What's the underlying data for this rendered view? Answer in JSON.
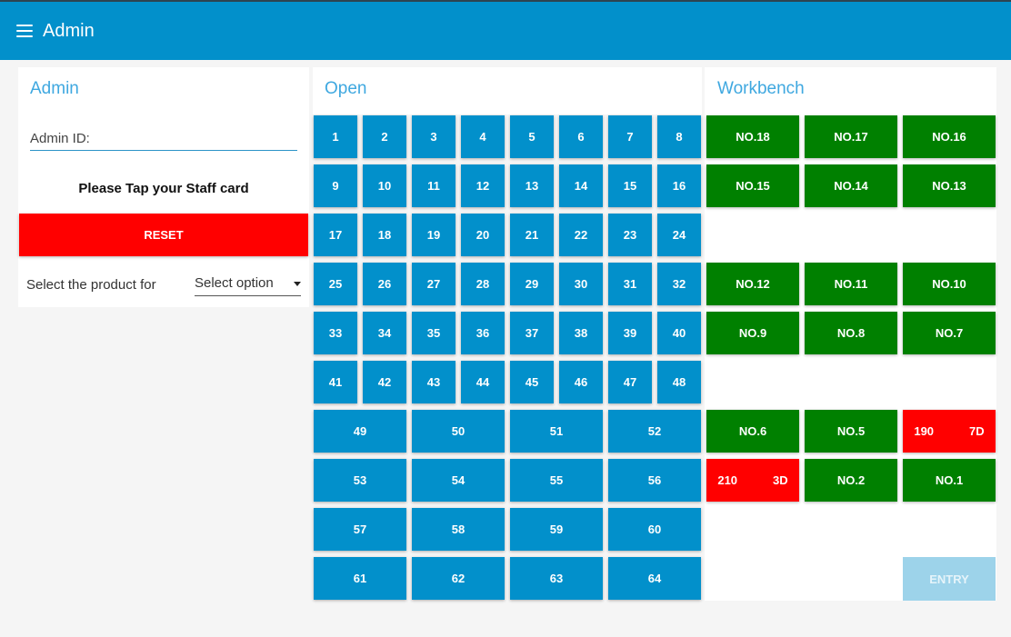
{
  "topbar": {
    "title": "Admin"
  },
  "admin": {
    "title": "Admin",
    "id_label": "Admin ID:",
    "tap_message": "Please Tap your Staff card",
    "reset_label": "RESET",
    "select_label": "Select the product for",
    "select_value": "Select option"
  },
  "open": {
    "title": "Open",
    "small_slots": [
      "1",
      "2",
      "3",
      "4",
      "5",
      "6",
      "7",
      "8",
      "9",
      "10",
      "11",
      "12",
      "13",
      "14",
      "15",
      "16",
      "17",
      "18",
      "19",
      "20",
      "21",
      "22",
      "23",
      "24",
      "25",
      "26",
      "27",
      "28",
      "29",
      "30",
      "31",
      "32",
      "33",
      "34",
      "35",
      "36",
      "37",
      "38",
      "39",
      "40",
      "41",
      "42",
      "43",
      "44",
      "45",
      "46",
      "47",
      "48"
    ],
    "large_slots": [
      "49",
      "50",
      "51",
      "52",
      "53",
      "54",
      "55",
      "56",
      "57",
      "58",
      "59",
      "60",
      "61",
      "62",
      "63",
      "64"
    ]
  },
  "workbench": {
    "title": "Workbench",
    "rows": [
      [
        {
          "label": "NO.18",
          "status": "green"
        },
        {
          "label": "NO.17",
          "status": "green"
        },
        {
          "label": "NO.16",
          "status": "green"
        }
      ],
      [
        {
          "label": "NO.15",
          "status": "green"
        },
        {
          "label": "NO.14",
          "status": "green"
        },
        {
          "label": "NO.13",
          "status": "green"
        }
      ],
      null,
      [
        {
          "label": "NO.12",
          "status": "green"
        },
        {
          "label": "NO.11",
          "status": "green"
        },
        {
          "label": "NO.10",
          "status": "green"
        }
      ],
      [
        {
          "label": "NO.9",
          "status": "green"
        },
        {
          "label": "NO.8",
          "status": "green"
        },
        {
          "label": "NO.7",
          "status": "green"
        }
      ],
      null,
      [
        {
          "label": "NO.6",
          "status": "green"
        },
        {
          "label": "NO.5",
          "status": "green"
        },
        {
          "label": "190   7D",
          "status": "red"
        }
      ],
      [
        {
          "label": "210   3D",
          "status": "red"
        },
        {
          "label": "NO.2",
          "status": "green"
        },
        {
          "label": "NO.1",
          "status": "green"
        }
      ]
    ],
    "entry_label": "ENTRY"
  },
  "colors": {
    "header": "#0290cb",
    "tile": "#0290cb",
    "green": "#008000",
    "red": "#ff0000",
    "accent_text": "#3fa8e0",
    "entry_disabled": "#9dd3ea"
  }
}
